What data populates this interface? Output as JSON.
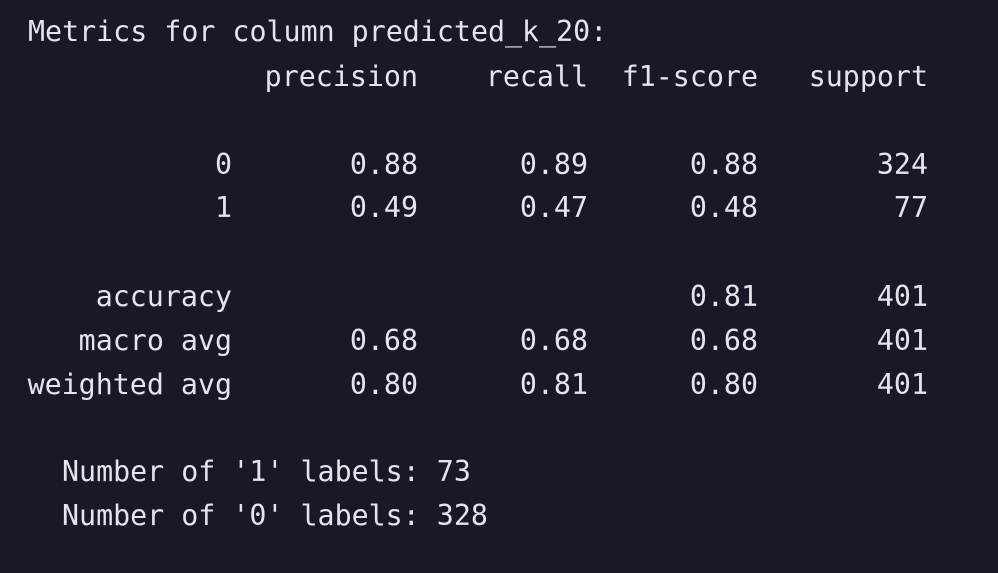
{
  "output": {
    "heading": "Metrics for column predicted_k_20:",
    "columns": [
      "precision",
      "recall",
      "f1-score",
      "support"
    ],
    "rows": [
      {
        "label": "0",
        "precision": "0.88",
        "recall": "0.89",
        "f1": "0.88",
        "support": "324"
      },
      {
        "label": "1",
        "precision": "0.49",
        "recall": "0.47",
        "f1": "0.48",
        "support": "77"
      }
    ],
    "summary": [
      {
        "label": "accuracy",
        "precision": "",
        "recall": "",
        "f1": "0.81",
        "support": "401"
      },
      {
        "label": "macro avg",
        "precision": "0.68",
        "recall": "0.68",
        "f1": "0.68",
        "support": "401"
      },
      {
        "label": "weighted avg",
        "precision": "0.80",
        "recall": "0.81",
        "f1": "0.80",
        "support": "401"
      }
    ],
    "label_counts": [
      "Number of '1' labels: 73",
      "Number of '0' labels: 328"
    ]
  }
}
